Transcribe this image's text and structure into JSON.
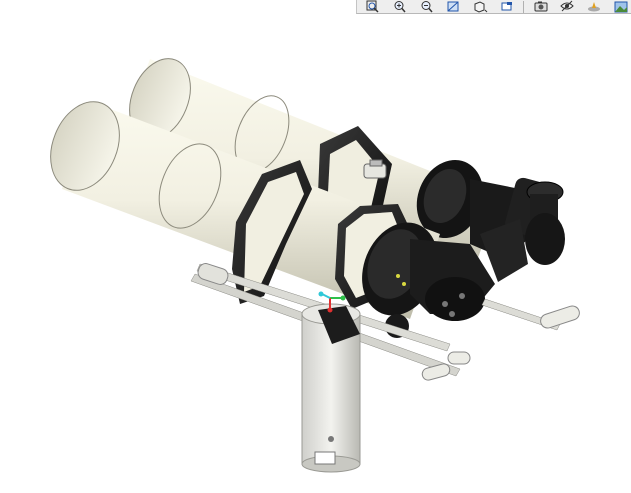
{
  "toolbar": {
    "buttons": [
      {
        "icon": "zoom-box-icon"
      },
      {
        "icon": "zoom-in-icon"
      },
      {
        "icon": "zoom-out-icon"
      },
      {
        "icon": "view-orientation-icon"
      },
      {
        "icon": "display-style-icon"
      },
      {
        "icon": "section-view-icon"
      },
      {
        "icon": "camera-icon"
      },
      {
        "icon": "hide-show-icon"
      },
      {
        "icon": "appearance-icon"
      },
      {
        "icon": "scene-icon"
      }
    ]
  },
  "model": {
    "object": "binocular-telescope-assembly",
    "colors": {
      "tube": "#f2f0e2",
      "tube_shadow": "#c9c7b6",
      "ring": "#1c1c1c",
      "metal": "#dadad6",
      "triad_x": "#e03030",
      "triad_y": "#2ec04a",
      "triad_z": "#30c8d8"
    }
  }
}
